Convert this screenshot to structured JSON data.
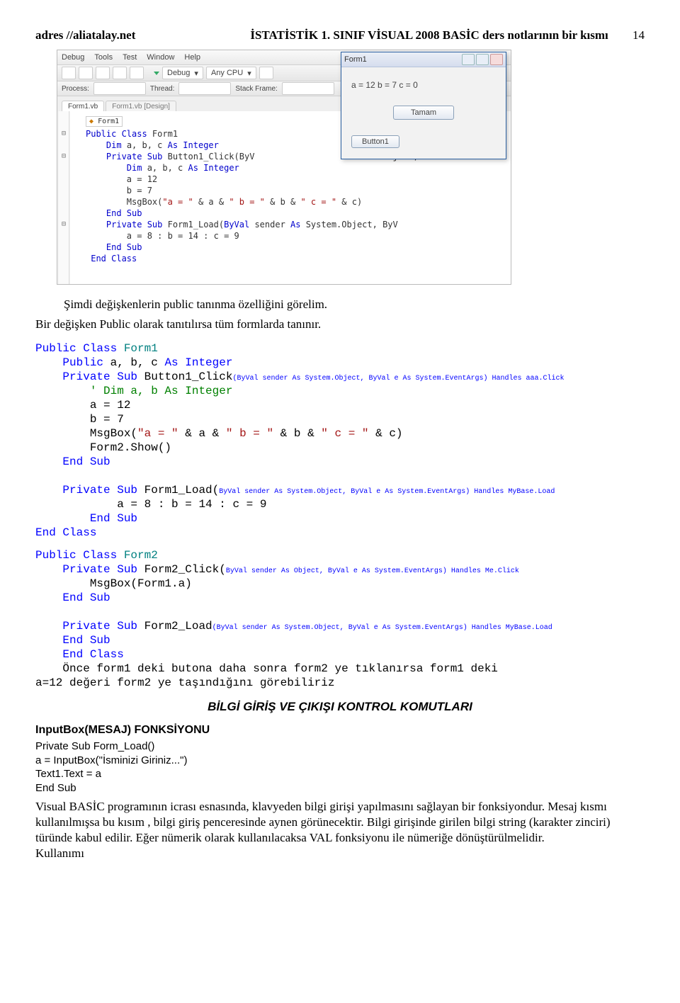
{
  "header": {
    "left": "adres //aliatalay.net",
    "right": "İSTATİSTİK 1. SINIF VİSUAL 2008 BASİC ders notlarının bir kısmı",
    "page_number": "14"
  },
  "ide": {
    "menu": [
      "Debug",
      "Tools",
      "Test",
      "Window",
      "Help"
    ],
    "toolbar": {
      "config": "Debug",
      "cpu": "Any CPU"
    },
    "toolbar2": {
      "process": "Process:",
      "thread": "Thread:",
      "stack": "Stack Frame:"
    },
    "tabs": {
      "active": "Form1.vb",
      "inactive": "Form1.vb [Design]"
    },
    "nav_left": "Form1",
    "form_window": {
      "title": "Form1",
      "label_text": "a = 12 b = 7 c = 0",
      "button_ok": "Tamam",
      "button_b1": "Button1"
    },
    "code_lines": [
      "Public Class Form1",
      "    Dim a, b, c As Integer",
      "    Private Sub Button1_Click(ByV                           ject,",
      "        Dim a, b, c As Integer",
      "        a = 12",
      "        b = 7",
      "        MsgBox(\"a = \" & a & \" b = \" & b & \" c = \" & c)",
      "    End Sub",
      "    Private Sub Form1_Load(ByVal sender As System.Object, ByV",
      "        a = 8 : b = 14 : c = 9",
      "    End Sub",
      " End Class"
    ]
  },
  "intro_line": "Şimdi değişkenlerin  public tanınma özelliğini görelim.",
  "intro_line2": "Bir değişken Public olarak tanıtılırsa tüm formlarda tanınır.",
  "code1": {
    "l1a": "Public",
    "l1b": " Class",
    "l1c": " Form1",
    "l2a": "    Public",
    "l2b": " a, b, c ",
    "l2c": "As",
    "l2d": " Integer",
    "l3a": "    Private",
    "l3b": " Sub",
    "l3c": " Button1_Click",
    "l3s": "(ByVal sender As System.Object, ByVal e As System.EventArgs) Handles aaa.Click",
    "l4": "        ' Dim a, b As Integer",
    "l5": "        a = 12",
    "l6": "        b = 7",
    "l7a": "        MsgBox(",
    "l7b": "\"a = \"",
    "l7c": " & a & ",
    "l7d": "\" b = \"",
    "l7e": " & b & ",
    "l7f": "\" c = \"",
    "l7g": " & c)",
    "l8": "        Form2.Show()",
    "l9a": "    End",
    "l9b": " Sub",
    "l10a": "    Private",
    "l10b": " Sub",
    "l10c": " Form1_Load(",
    "l10s": "ByVal sender As System.Object, ByVal e As System.EventArgs) Handles MyBase.Load",
    "l11": "            a = 8 : b = 14 : c = 9",
    "l12a": "        End",
    "l12b": " Sub",
    "l13a": "End",
    "l13b": " Class"
  },
  "code2": {
    "l1a": "Public",
    "l1b": " Class",
    "l1c": " Form2",
    "l2a": "    Private",
    "l2b": " Sub",
    "l2c": " Form2_Click(",
    "l2s": "ByVal sender As Object, ByVal e As System.EventArgs) Handles Me.Click",
    "l3": "        MsgBox(Form1.a)",
    "l4a": "    End",
    "l4b": " Sub",
    "l5a": "    Private",
    "l5b": " Sub",
    "l5c": " Form2_Load",
    "l5s": "(ByVal sender As System.Object, ByVal e As System.EventArgs) Handles MyBase.Load",
    "l6a": "    End",
    "l6b": " Sub",
    "l7a": "    End",
    "l7b": " Class",
    "desc1": "    Önce form1 deki butona daha sonra form2 ye tıklanırsa form1 deki",
    "desc2": "a=12 değeri form2 ye taşındığını görebiliriz"
  },
  "heading_center": "BİLGİ GİRİŞ VE ÇIKIŞI KONTROL KOMUTLARI",
  "inputbox": {
    "title": "InputBox(MESAJ) FONKSİYONU",
    "l1": "Private Sub Form_Load()",
    "l2": "a = InputBox(\"İsminizi Giriniz...\")",
    "l3": "Text1.Text = a",
    "l4": "End Sub"
  },
  "bottom_para": "Visual BASİC programının icrası esnasında, klavyeden bilgi girişi yapılmasını sağlayan bir fonksiyondur. Mesaj kısmı kullanılmışsa bu  kısım , bilgi giriş penceresinde aynen görünecektir. Bilgi girişinde girilen bilgi string (karakter zinciri) türünde kabul edilir. Eğer nümerik olarak kullanılacaksa VAL fonksiyonu ile nümeriğe dönüştürülmelidir.",
  "bottom_last": "Kullanımı"
}
